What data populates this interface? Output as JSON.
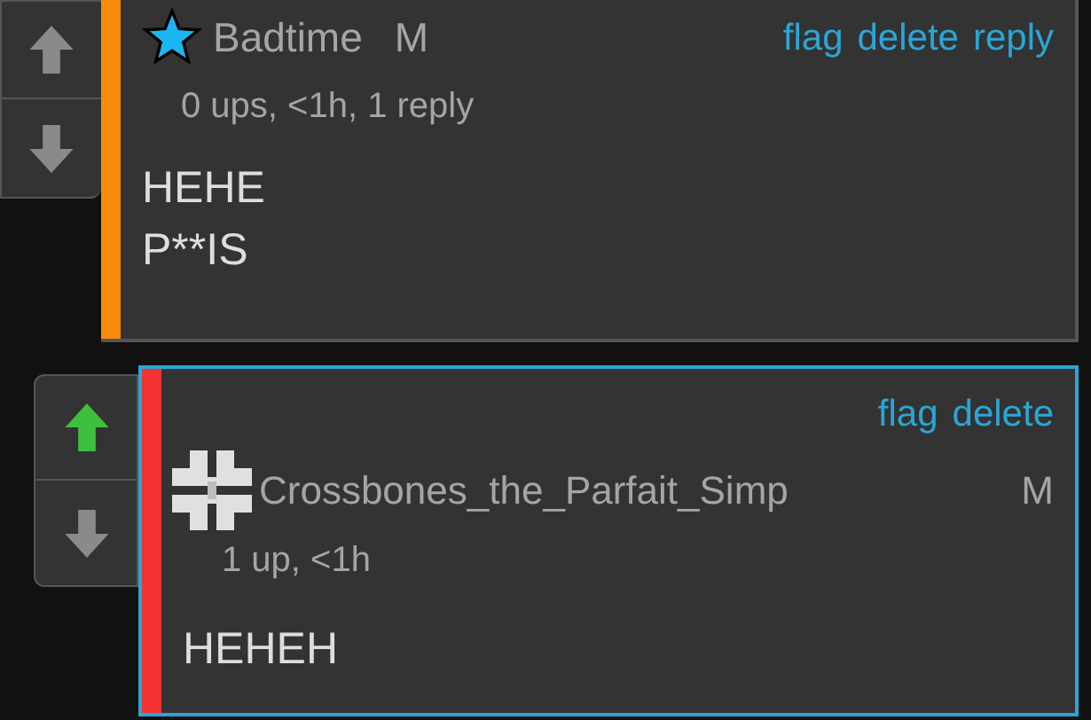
{
  "comments": [
    {
      "avatar": {
        "kind": "star"
      },
      "username": "Badtime",
      "gender": "M",
      "meta": "0 ups, <1h, 1 reply",
      "body": [
        "HEHE",
        "P**IS"
      ],
      "actions": [
        "flag",
        "delete",
        "reply"
      ],
      "upvoted": false,
      "downvoted": false,
      "highlighted": false,
      "color": "#f98b0b"
    },
    {
      "avatar": {
        "kind": "cross"
      },
      "username": "Crossbones_the_Parfait_Simp",
      "gender": "M",
      "meta": "1 up, <1h",
      "body": [
        "HEHEH"
      ],
      "actions": [
        "flag",
        "delete"
      ],
      "upvoted": true,
      "downvoted": false,
      "highlighted": true,
      "color": "#f43232"
    }
  ]
}
